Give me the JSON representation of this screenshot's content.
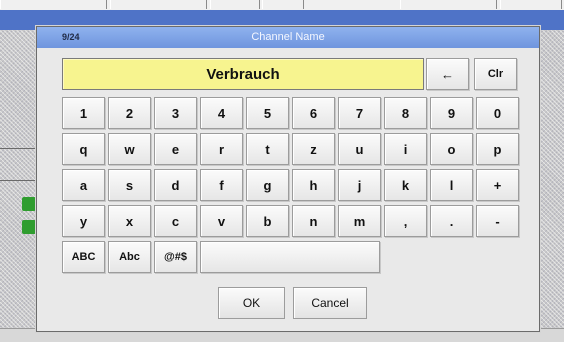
{
  "dialog": {
    "counter": "9/24",
    "title": "Channel Name",
    "value": "Verbrauch"
  },
  "keys": {
    "backspace": "←",
    "clear": "Clr",
    "row1": [
      "1",
      "2",
      "3",
      "4",
      "5",
      "6",
      "7",
      "8",
      "9",
      "0"
    ],
    "row2": [
      "q",
      "w",
      "e",
      "r",
      "t",
      "z",
      "u",
      "i",
      "o",
      "p"
    ],
    "row3": [
      "a",
      "s",
      "d",
      "f",
      "g",
      "h",
      "j",
      "k",
      "l",
      "+"
    ],
    "row4": [
      "y",
      "x",
      "c",
      "v",
      "b",
      "n",
      "m",
      ",",
      ".",
      "-"
    ],
    "mode_upper": "ABC",
    "mode_mixed": "Abc",
    "mode_symbols": "@#$"
  },
  "actions": {
    "ok": "OK",
    "cancel": "Cancel"
  }
}
